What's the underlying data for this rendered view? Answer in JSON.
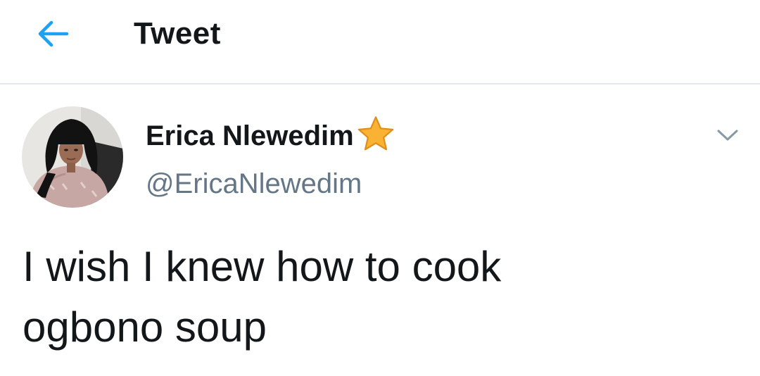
{
  "header": {
    "title": "Tweet",
    "back_icon": "arrow-left-icon",
    "accent_color": "#1da1f2"
  },
  "tweet": {
    "author": {
      "display_name": "Erica Nlewedim",
      "username": "@EricaNlewedim",
      "badge_icon": "star-icon",
      "avatar_icon": "profile-photo"
    },
    "menu_icon": "chevron-down-icon",
    "text": "I wish I knew how to cook\nogbono soup"
  }
}
